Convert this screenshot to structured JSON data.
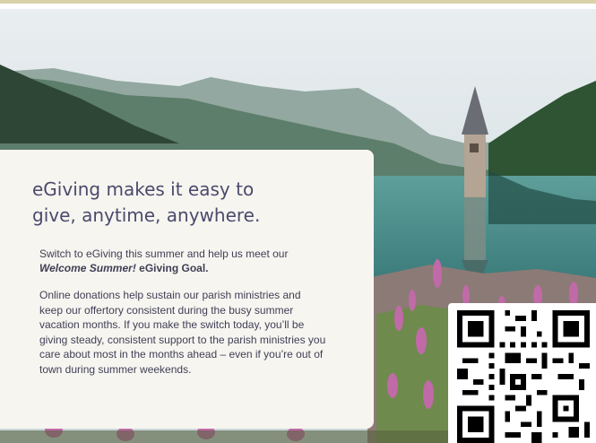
{
  "card": {
    "headline": "eGiving makes it easy to give, anytime, anywhere.",
    "intro_line": "Switch to eGiving this summer and help us meet our",
    "goal_italic": "Welcome Summer!",
    "goal_rest": " eGiving Goal.",
    "body": "Online donations help sustain our parish ministries and keep our offertory consistent during the busy summer vacation months. If you make the switch today, you’ll be giving steady, consistent support to the parish ministries you care about most in the months ahead – even if you’re out of town during summer weekends."
  },
  "colors": {
    "headline": "#4a4a6c",
    "body_text": "#3f3f55",
    "card_bg": "#f7f5f0",
    "accent_strip": "#d9d1a8"
  },
  "icons": [
    "qr-code-icon"
  ]
}
